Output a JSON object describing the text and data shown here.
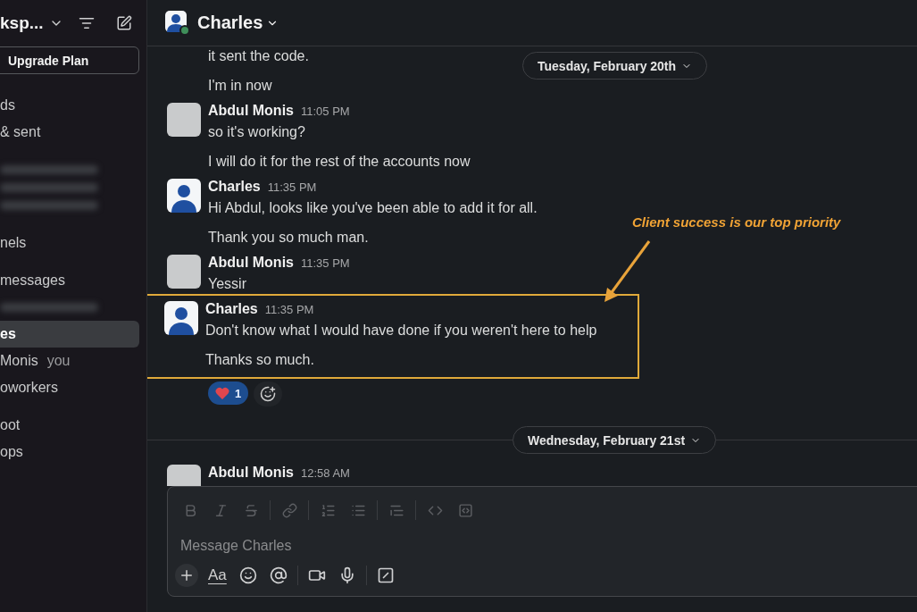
{
  "sidebar": {
    "workspace_name": "ksp...",
    "upgrade_button": "Upgrade Plan",
    "groups": [
      {
        "items": [
          {
            "kind": "item",
            "label": "ds",
            "selected": false
          },
          {
            "kind": "item",
            "label": "& sent",
            "selected": false
          }
        ]
      },
      {
        "items": [
          {
            "kind": "blurred"
          },
          {
            "kind": "blurred"
          },
          {
            "kind": "blurred"
          }
        ]
      },
      {
        "items": [
          {
            "kind": "item",
            "label": "nels",
            "selected": false
          }
        ]
      },
      {
        "items": [
          {
            "kind": "item",
            "label": "messages",
            "selected": false
          },
          {
            "kind": "blurred"
          },
          {
            "kind": "item",
            "label": "es",
            "selected": true
          },
          {
            "kind": "item",
            "label": "Monis",
            "suffix": "you",
            "selected": false
          },
          {
            "kind": "item",
            "label": "oworkers",
            "selected": false
          }
        ]
      },
      {
        "items": [
          {
            "kind": "item",
            "label": "oot",
            "selected": false
          },
          {
            "kind": "item",
            "label": "ops",
            "selected": false
          }
        ]
      }
    ]
  },
  "channel": {
    "title": "Charles",
    "online": true
  },
  "sticky_date": "Tuesday, February 20th",
  "timeline": [
    {
      "kind": "continuation",
      "lines": [
        "it sent the code.",
        "I'm in now"
      ]
    },
    {
      "kind": "message",
      "author": "Abdul Monis",
      "avatar": {
        "kind": "photo"
      },
      "time": "11:05 PM",
      "lines": [
        "so it's working?",
        "I will do it for the rest of the accounts now"
      ],
      "highlighted": false
    },
    {
      "kind": "message",
      "author": "Charles",
      "avatar": {
        "kind": "default"
      },
      "time": "11:35 PM",
      "lines": [
        "Hi Abdul, looks like you've been able to add it for all.",
        "Thank you so much man."
      ],
      "highlighted": false
    },
    {
      "kind": "message",
      "author": "Abdul Monis",
      "avatar": {
        "kind": "photo"
      },
      "time": "11:35 PM",
      "lines": [
        "Yessir"
      ],
      "highlighted": false
    },
    {
      "kind": "message",
      "author": "Charles",
      "avatar": {
        "kind": "default"
      },
      "time": "11:35 PM",
      "lines": [
        "Don't know what I would have done if you weren't here to help",
        "Thanks so much."
      ],
      "highlighted": true,
      "reactions": [
        {
          "count": "1",
          "reacted": true
        }
      ]
    },
    {
      "kind": "day",
      "label": "Wednesday, February 21st"
    },
    {
      "kind": "message",
      "author": "Abdul Monis",
      "avatar": {
        "kind": "photo"
      },
      "time": "12:58 AM",
      "highlighted": false
    }
  ],
  "annotation": {
    "text": "Client success is our top priority"
  },
  "composer": {
    "placeholder": "Message Charles",
    "format_label": "Aa"
  }
}
